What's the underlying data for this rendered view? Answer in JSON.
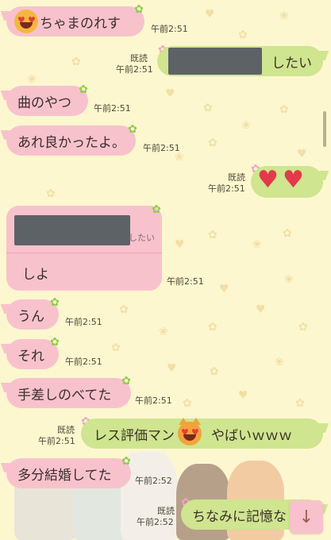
{
  "messages": [
    {
      "id": "m1",
      "text": "ちゃまのれす",
      "time": "午前2:51"
    },
    {
      "id": "m2",
      "text": "したい",
      "time": "午前2:51",
      "read": "既読"
    },
    {
      "id": "m3",
      "text": "曲のやつ",
      "time": "午前2:51"
    },
    {
      "id": "m4",
      "text": "あれ良かったよ。",
      "time": "午前2:51"
    },
    {
      "id": "m5",
      "time": "午前2:51",
      "read": "既読"
    },
    {
      "id": "m6",
      "quote_suffix": "したい",
      "text": "しよ",
      "time": "午前2:51"
    },
    {
      "id": "m7",
      "text": "うん",
      "time": "午前2:51"
    },
    {
      "id": "m8",
      "text": "それ",
      "time": "午前2:51"
    },
    {
      "id": "m9",
      "text": "手差しのべてた",
      "time": "午前2:51"
    },
    {
      "id": "m10",
      "text_a": "レス評価マン",
      "text_b": "やばいｗｗｗ",
      "time": "午前2:51",
      "read": "既読"
    },
    {
      "id": "m11",
      "text": "多分結婚してた",
      "time": "午前2:52"
    },
    {
      "id": "m12",
      "text": "ちなみに記憶な",
      "time": "午前2:52",
      "read": "既読"
    }
  ],
  "icons": {
    "scroll_down": "arrow-down-icon",
    "status": "flower-icon"
  },
  "colors": {
    "background": "#fdf7cf",
    "incoming_bubble": "#f8c2cc",
    "outgoing_bubble": "#cfe58f"
  }
}
